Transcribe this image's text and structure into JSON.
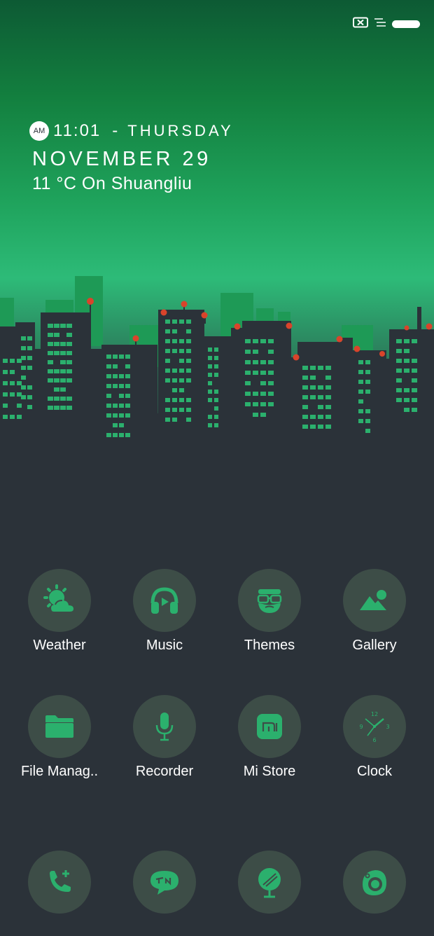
{
  "status_bar": {
    "icons": [
      "notification-off-icon",
      "menu-lines-icon",
      "battery-icon"
    ],
    "accent": "#ffffff"
  },
  "lockscreen": {
    "ampm": "AM",
    "time": "11:01",
    "separator": "-",
    "day": "THURSDAY",
    "date": "NOVEMBER 29",
    "weather": "11 °C On  Shuangliu"
  },
  "colors": {
    "sky_top": "#0d5a34",
    "sky_bottom": "#2dbb78",
    "background": "#2b3239",
    "buildings": "#2b3239",
    "windows": "#2bb06d",
    "antenna_lights": "#d9442b",
    "icon_circle": "#3d4d47",
    "icon_accent": "#2bb06d"
  },
  "apps": {
    "row1": [
      {
        "label": "Weather",
        "icon": "weather-sun-cloud-icon"
      },
      {
        "label": "Music",
        "icon": "headphones-icon"
      },
      {
        "label": "Themes",
        "icon": "bearded-face-icon"
      },
      {
        "label": "Gallery",
        "icon": "mountain-sun-icon"
      }
    ],
    "row2": [
      {
        "label": "File Manag..",
        "icon": "folder-icon"
      },
      {
        "label": "Recorder",
        "icon": "microphone-icon"
      },
      {
        "label": "Mi Store",
        "icon": "mi-store-bag-icon"
      },
      {
        "label": "Clock",
        "icon": "clock-face-icon"
      }
    ],
    "dock": [
      {
        "label": "",
        "icon": "phone-icon"
      },
      {
        "label": "",
        "icon": "textnow-bubble-icon"
      },
      {
        "label": "",
        "icon": "browser-globe-icon"
      },
      {
        "label": "",
        "icon": "camera-lens-icon"
      }
    ]
  }
}
